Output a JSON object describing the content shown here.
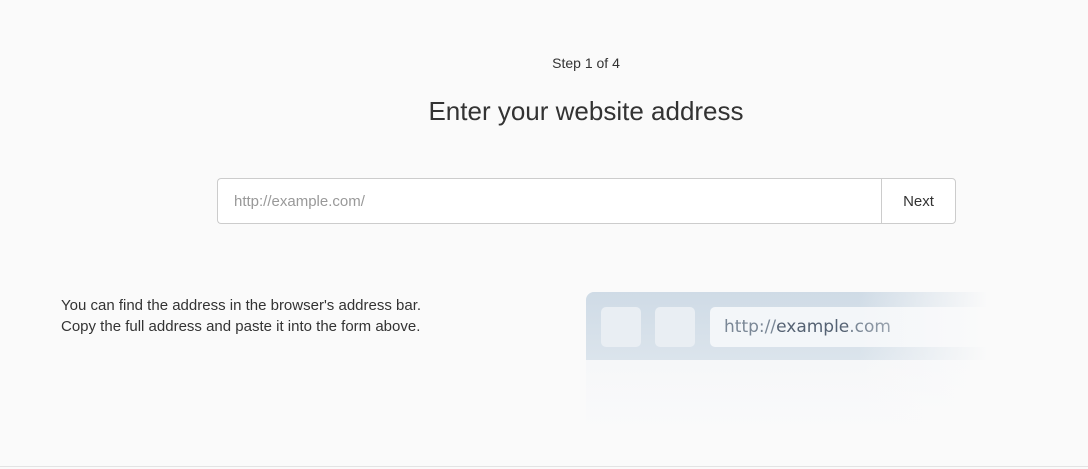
{
  "wizard": {
    "step_label": "Step 1 of 4",
    "title": "Enter your website address"
  },
  "form": {
    "url_placeholder": "http://example.com/",
    "url_value": "",
    "next_label": "Next"
  },
  "help": {
    "line1": "You can find the address in the browser's address bar.",
    "line2": "Copy the full address and paste it into the form above."
  },
  "illustration": {
    "address_prefix": "http://",
    "address_domain": "example",
    "address_suffix": ".com"
  }
}
